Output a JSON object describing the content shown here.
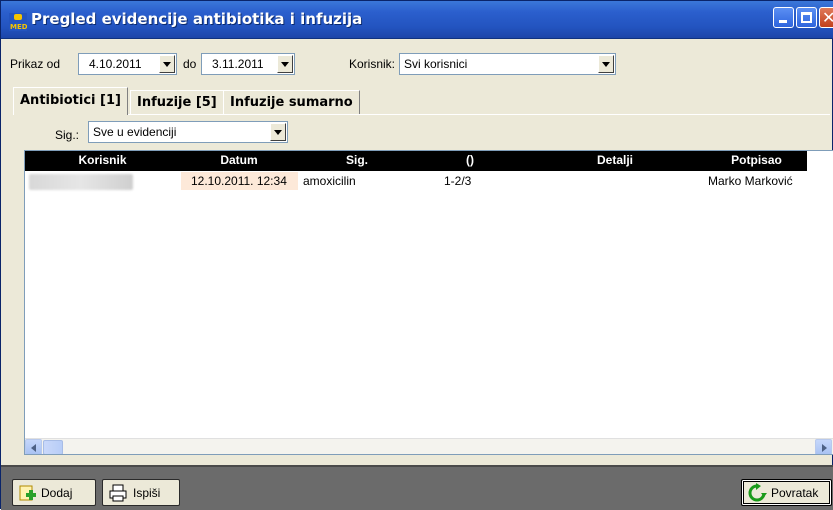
{
  "window": {
    "title": "Pregled evidencije antibiotika i infuzija",
    "icon": "med-app-icon"
  },
  "filters": {
    "prikaz_od_label": "Prikaz od",
    "date_from": "4.10.2011",
    "do_label": "do",
    "date_to": "3.11.2011",
    "korisnik_label": "Korisnik:",
    "korisnik_value": "Svi korisnici"
  },
  "tabs": [
    {
      "label": "Antibiotici [1]",
      "active": true
    },
    {
      "label": "Infuzije [5]",
      "active": false
    },
    {
      "label": "Infuzije sumarno",
      "active": false
    }
  ],
  "sig_filter": {
    "label": "Sig.:",
    "value": "Sve u evidenciji"
  },
  "table": {
    "columns": [
      "Korisnik",
      "Datum",
      "Sig.",
      "()",
      "Detalji",
      "Potpisao"
    ],
    "rows": [
      {
        "korisnik": "",
        "datum": "12.10.2011.  12:34",
        "sig": "amoxicilin",
        "dose": "1-2/3",
        "detalji": "",
        "potpisao": "Marko Marković"
      }
    ]
  },
  "buttons": {
    "dodaj": "Dodaj",
    "ispisi": "Ispiši",
    "povratak": "Povratak"
  },
  "colors": {
    "titlebar": "#2354c0",
    "window_bg": "#ece9d8",
    "bottom_bar": "#6b6b6b",
    "table_header": "#000000",
    "date_cell": "#fde9d9"
  }
}
